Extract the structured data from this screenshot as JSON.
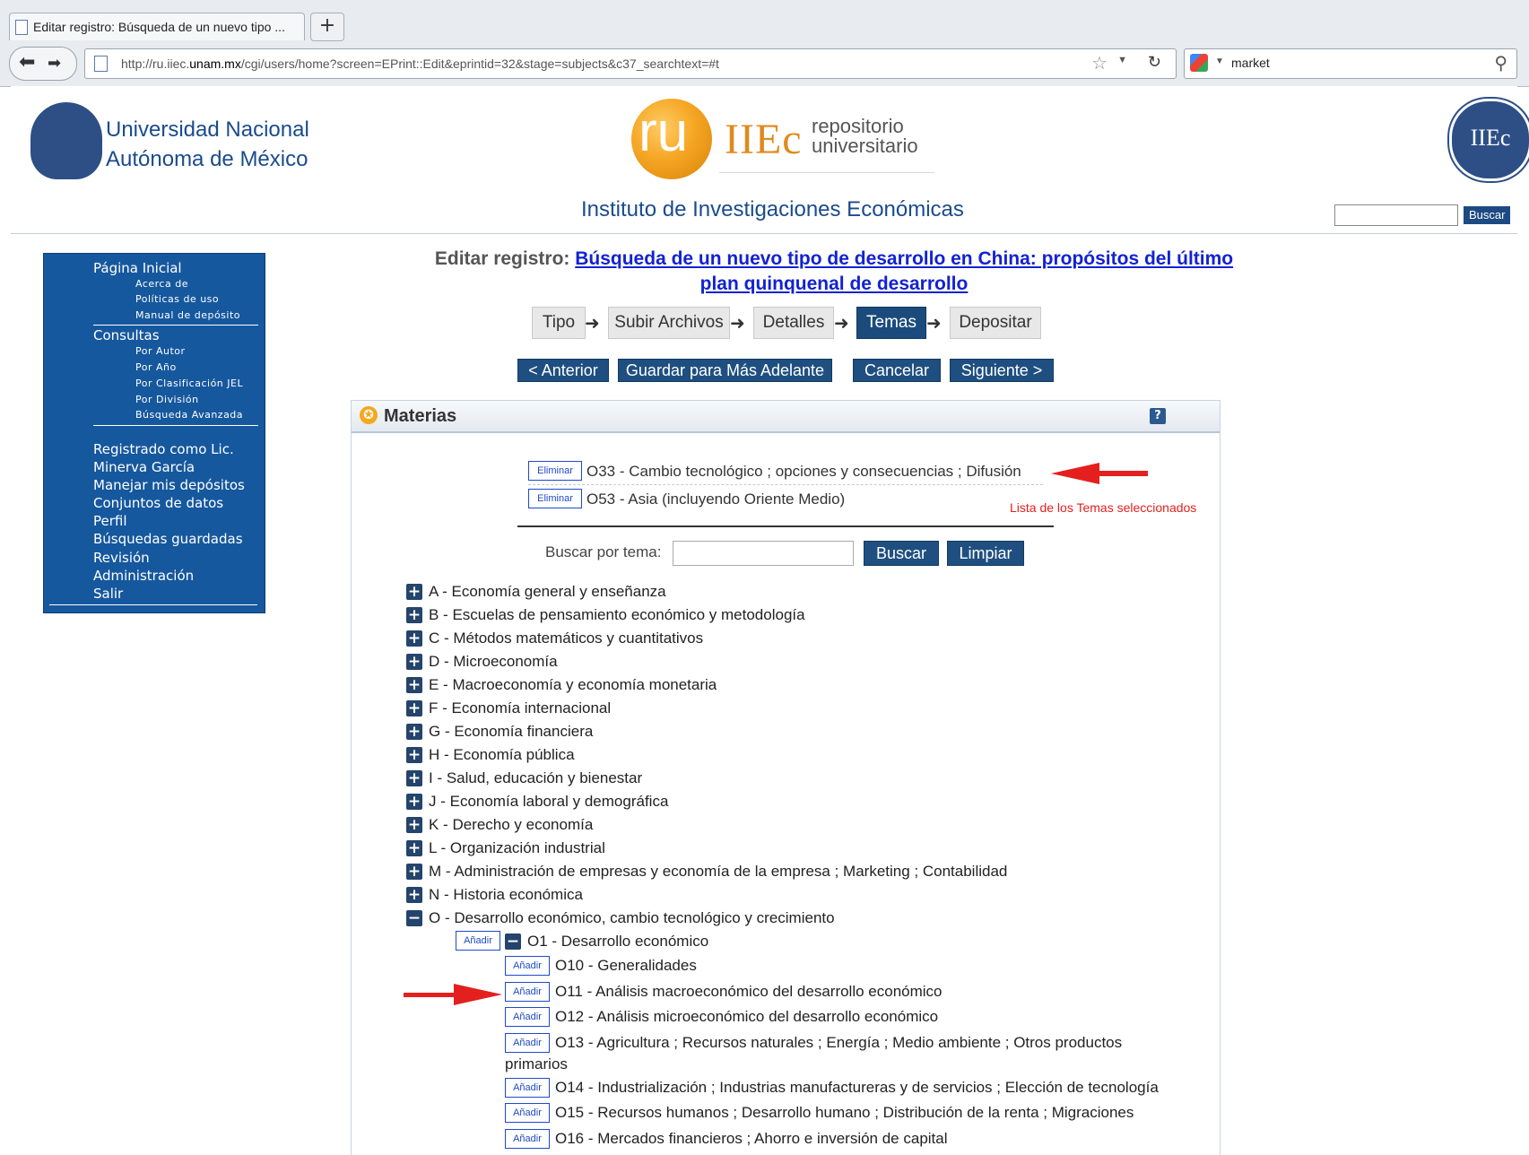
{
  "browser": {
    "tab_title": "Editar registro: Búsqueda de un nuevo tipo ...",
    "new_tab": "+",
    "url_prefix": "http://ru.iiec.",
    "url_domain": "unam.mx",
    "url_rest": "/cgi/users/home?screen=EPrint::Edit&eprintid=32&stage=subjects&c37_searchtext=#t",
    "search_value": "market"
  },
  "header": {
    "university_line1": "Universidad Nacional",
    "university_line2": "Autónoma de México",
    "logo_ru": "ru",
    "logo_iiec": "IIEc",
    "logo_repo1": "repositorio",
    "logo_repo2": "universitario",
    "institute": "Instituto de Investigaciones Económicas",
    "seal_text": "IIEc",
    "search_button": "Buscar"
  },
  "sidebar": {
    "home": "Página Inicial",
    "home_sub": [
      "Acerca de",
      "Políticas de uso",
      "Manual de depósito"
    ],
    "consultas": "Consultas",
    "consultas_sub": [
      "Por Autor",
      "Por Año",
      "Por Clasificación JEL",
      "Por División",
      "Búsqueda Avanzada"
    ],
    "user_items": [
      "Registrado como Lic.",
      "Minerva García",
      "Manejar mis depósitos",
      "Conjuntos de datos",
      "Perfil",
      "Búsquedas guardadas",
      "Revisión",
      "Administración",
      "Salir"
    ]
  },
  "main": {
    "edit_label": "Editar registro:",
    "record_title_line1": "Búsqueda de un nuevo tipo de desarrollo en China: propósitos del último",
    "record_title_line2": "plan quinquenal de desarrollo",
    "stages": [
      "Tipo",
      "Subir Archivos",
      "Detalles",
      "Temas",
      "Depositar"
    ],
    "active_stage": "Temas",
    "actions": [
      "< Anterior",
      "Guardar para Más Adelante",
      "Cancelar",
      "Siguiente >"
    ]
  },
  "materias": {
    "title": "Materias",
    "help": "?",
    "remove_label": "Eliminar",
    "add_label": "Añadir",
    "selected": [
      "O33 - Cambio tecnológico ; opciones y consecuencias ; Difusión",
      "O53 - Asia (incluyendo Oriente Medio)"
    ],
    "annotation": "Lista de los Temas seleccionados",
    "search_label": "Buscar por tema:",
    "search_button": "Buscar",
    "clear_button": "Limpiar",
    "tree": [
      "A - Economía general y enseñanza",
      "B - Escuelas de pensamiento económico y metodología",
      "C - Métodos matemáticos y cuantitativos",
      "D - Microeconomía",
      "E - Macroeconomía y economía monetaria",
      "F - Economía internacional",
      "G - Economía financiera",
      "H - Economía pública",
      "I - Salud, educación y bienestar",
      "J - Economía laboral y demográfica",
      "K - Derecho y economía",
      "L - Organización industrial",
      "M - Administración de empresas y economía de la empresa ; Marketing ; Contabilidad",
      "N - Historia económica",
      "O - Desarrollo económico, cambio tecnológico y crecimiento"
    ],
    "o1": "O1 - Desarrollo económico",
    "o1_children": [
      "O10 - Generalidades",
      "O11 - Análisis macroeconómico del desarrollo económico",
      "O12 - Análisis microeconómico del desarrollo económico",
      "O13 - Agricultura ; Recursos naturales ; Energía ; Medio ambiente ; Otros productos",
      "O14 - Industrialización ; Industrias manufactureras y de servicios ; Elección de tecnología",
      "O15 - Recursos humanos ; Desarrollo humano ; Distribución de la renta ; Migraciones",
      "O16 - Mercados financieros ; Ahorro e inversión de capital"
    ],
    "o13_wrap": "primarios"
  }
}
